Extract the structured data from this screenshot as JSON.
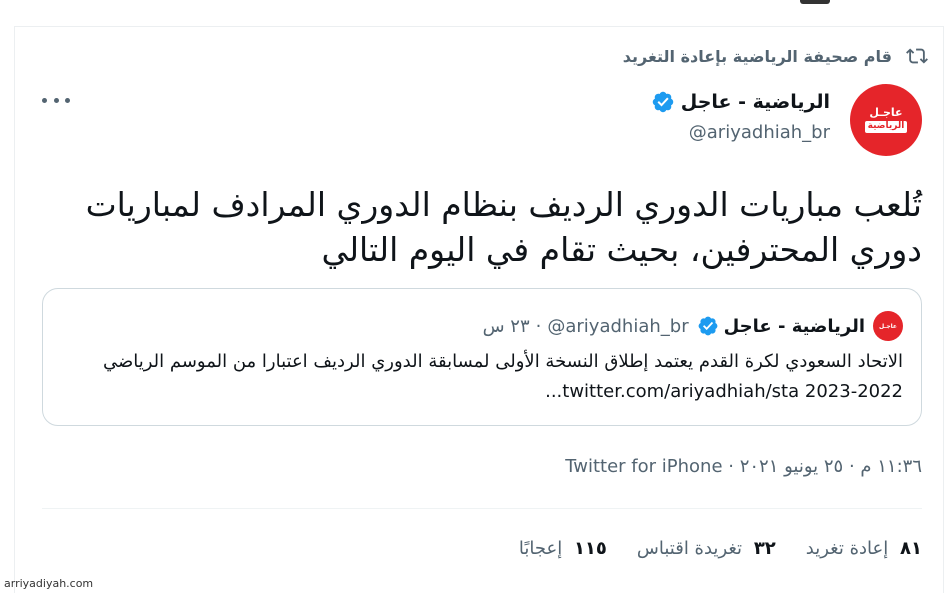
{
  "retweet_context": {
    "label": "قام صحيفة الرياضية بإعادة التغريد",
    "icon": "retweet-icon"
  },
  "author": {
    "display_name": "الرياضية - عاجل",
    "handle": "@ariyadhiah_br",
    "verified": true,
    "avatar_logo_top": "عاجـل",
    "avatar_logo_bottom": "الرياضية"
  },
  "tweet": {
    "text": "تُلعب مباريات الدوري الرديف بنظام الدوري المرادف لمباريات دوري المحترفين، بحيث تقام في اليوم التالي"
  },
  "quoted_tweet": {
    "display_name": "الرياضية - عاجل",
    "handle": "@ariyadhiah_br",
    "separator": "·",
    "time": "٢٣ س",
    "text": "الاتحاد السعودي لكرة القدم يعتمد إطلاق النسخة الأولى لمسابقة الدوري الرديف اعتبارا من الموسم الرياضي 2022-2023 twitter.com/ariyadhiah/sta..."
  },
  "meta": {
    "line": "١١:٣٦ م · ٢٥ يونيو ٢٠٢١ · Twitter for iPhone"
  },
  "stats": {
    "retweets_count": "٨١",
    "retweets_label": "إعادة تغريد",
    "quotes_count": "٣٢",
    "quotes_label": "تغريدة اقتباس",
    "likes_count": "١١٥",
    "likes_label": "إعجابًا"
  },
  "watermark": "arriyadiyah.com",
  "colors": {
    "accent_verified": "#1d9bf0",
    "secondary_text": "#536471",
    "brand_red": "#e5252a"
  }
}
